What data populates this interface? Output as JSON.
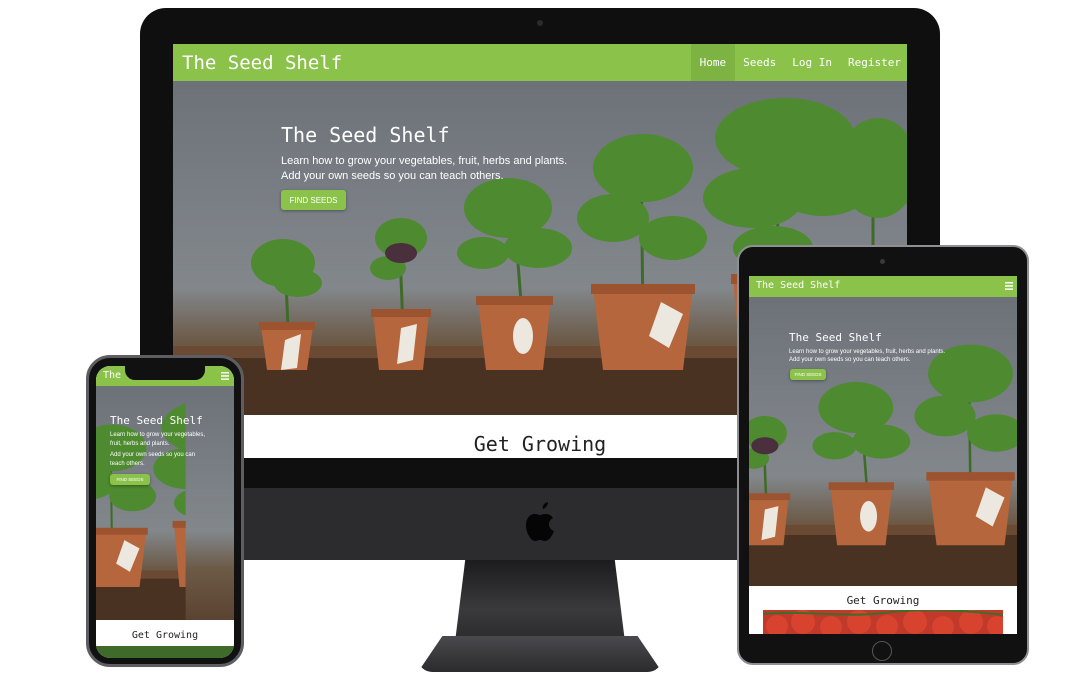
{
  "site": {
    "brand": "The Seed Shelf",
    "nav": [
      {
        "label": "Home",
        "active": true
      },
      {
        "label": "Seeds",
        "active": false
      },
      {
        "label": "Log In",
        "active": false
      },
      {
        "label": "Register",
        "active": false
      }
    ],
    "menu_icon": "hamburger-menu-icon",
    "hero": {
      "title": "The Seed Shelf",
      "line1": "Learn how to grow your vegetables, fruit, herbs and plants.",
      "line2": "Add your own seeds so you can teach others.",
      "button": "Find Seeds",
      "phone_line1a": "Learn how to grow your vegetables,",
      "phone_line1b": "fruit, herbs and plants.",
      "phone_line2a": "Add your own seeds so you can",
      "phone_line2b": "teach others."
    },
    "section_title": "Get Growing"
  },
  "colors": {
    "brand_green": "#8bc34a",
    "active_nav": "#7cb342",
    "device_black": "#0f0f10"
  },
  "icons": {
    "apple": "apple-logo-icon",
    "menu": "hamburger-menu-icon"
  }
}
